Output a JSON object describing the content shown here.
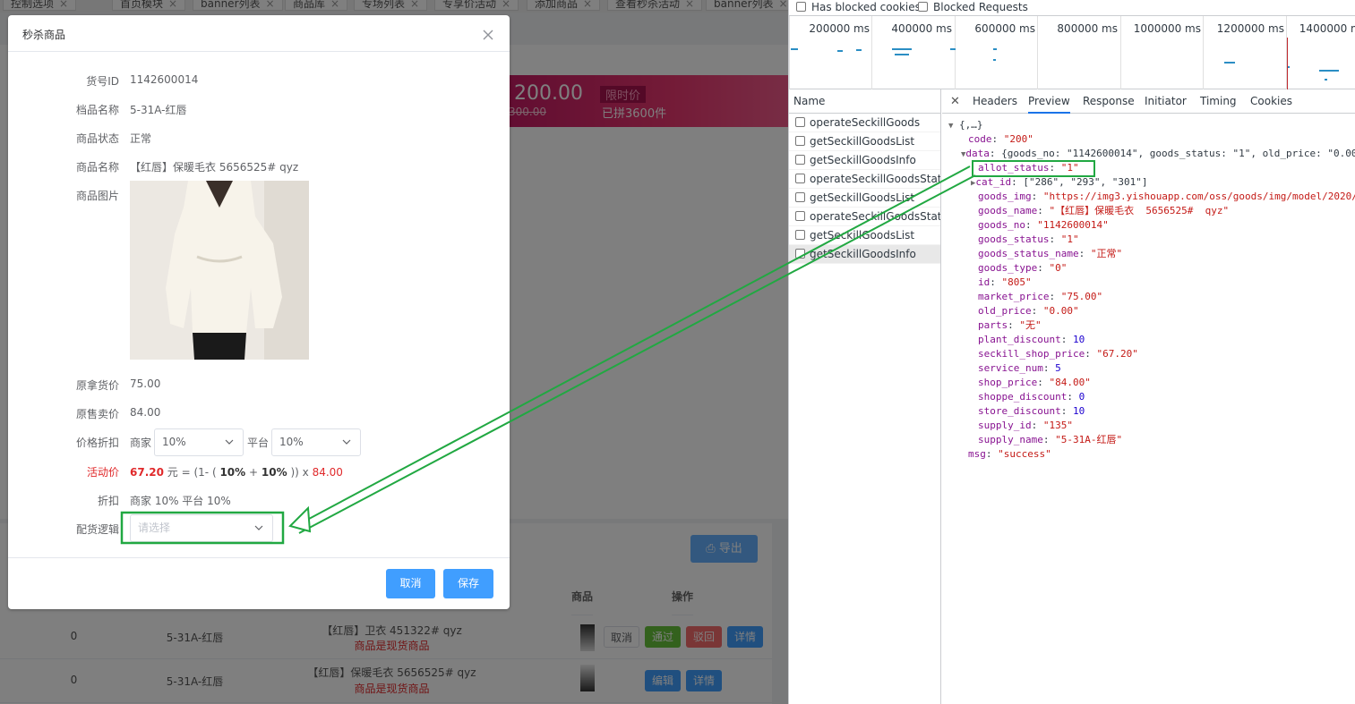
{
  "bg": {
    "tabs": [
      "控制选项",
      "首页模块",
      "banner列表",
      "商品库",
      "专场列表",
      "专享价活动",
      "添加商品",
      "查看秒杀活动",
      "banner列表"
    ],
    "banner_price": "200.00",
    "banner_old": "300.00",
    "banner_tag": "限时价",
    "banner_sold": "已拼3600件",
    "export_label": "导出",
    "table_headers": {
      "goods": "商品",
      "actions": "操作"
    },
    "rows": [
      {
        "count": "0",
        "supplier": "5-31A-红唇",
        "name": "【红唇】卫衣 451322# qyz",
        "note": "商品是现货商品",
        "btn_cancel": "取消",
        "btn_pass": "通过",
        "btn_reject": "驳回",
        "btn_detail": "详情"
      },
      {
        "count": "0",
        "supplier": "5-31A-红唇",
        "name": "【红唇】保暖毛衣 5656525# qyz",
        "note": "商品是现货商品",
        "btn_edit": "编辑",
        "btn_detail": "详情"
      }
    ]
  },
  "dialog": {
    "title": "秒杀商品",
    "fields": {
      "goods_id_label": "货号ID",
      "goods_id": "1142600014",
      "supplier_label": "档品名称",
      "supplier": "5-31A-红唇",
      "status_label": "商品状态",
      "status": "正常",
      "name_label": "商品名称",
      "name": "【红唇】保暖毛衣 5656525# qyz",
      "image_label": "商品图片",
      "cost_label": "原拿货价",
      "cost": "75.00",
      "sale_label": "原售卖价",
      "sale": "84.00",
      "discount_label": "价格折扣",
      "merchant_label": "商家",
      "merchant_value": "10%",
      "platform_label": "平台",
      "platform_value": "10%",
      "activity_label": "活动价",
      "activity_price": "67.20",
      "formula_a": "元 = (1- (",
      "formula_pct1": "10%",
      "formula_plus": "+",
      "formula_pct2": "10%",
      "formula_b": ")) x",
      "formula_base": "84.00",
      "rebate_label": "折扣",
      "rebate_value": "商家 10% 平台 10%",
      "delivery_label": "配货逻辑",
      "delivery_placeholder": "请选择"
    },
    "cancel_label": "取消",
    "save_label": "保存"
  },
  "devtools": {
    "filter_blocked_cookies": "Has blocked cookies",
    "filter_blocked_requests": "Blocked Requests",
    "timeline_labels": [
      "200000 ms",
      "400000 ms",
      "600000 ms",
      "800000 ms",
      "1000000 ms",
      "1200000 ms",
      "1400000 ms"
    ],
    "names_header": "Name",
    "requests": [
      "operateSeckillGoods",
      "getSeckillGoodsList",
      "getSeckillGoodsInfo",
      "operateSeckillGoodsStatus",
      "getSeckillGoodsList",
      "operateSeckillGoodsStatus",
      "getSeckillGoodsList",
      "getSeckillGoodsInfo"
    ],
    "tabs": [
      "Headers",
      "Preview",
      "Response",
      "Initiator",
      "Timing",
      "Cookies"
    ],
    "active_tab": "Preview",
    "json_root": "{,…}",
    "json_lines": [
      {
        "k": "code",
        "v": "\"200\"",
        "t": "s"
      },
      {
        "k": "data",
        "v": "{goods_no: \"1142600014\", goods_status: \"1\", old_price: \"0.00\"",
        "t": "p"
      },
      {
        "k": "allot_status",
        "v": "\"1\"",
        "t": "s"
      },
      {
        "k": "cat_id",
        "v": "[\"286\", \"293\", \"301\"]",
        "t": "p"
      },
      {
        "k": "goods_img",
        "v": "\"https://img3.yishouapp.com/oss/goods/img/model/2020/",
        "t": "s"
      },
      {
        "k": "goods_name",
        "v": "\"【红唇】保暖毛衣  5656525#  qyz\"",
        "t": "s"
      },
      {
        "k": "goods_no",
        "v": "\"1142600014\"",
        "t": "s"
      },
      {
        "k": "goods_status",
        "v": "\"1\"",
        "t": "s"
      },
      {
        "k": "goods_status_name",
        "v": "\"正常\"",
        "t": "s"
      },
      {
        "k": "goods_type",
        "v": "\"0\"",
        "t": "s"
      },
      {
        "k": "id",
        "v": "\"805\"",
        "t": "s"
      },
      {
        "k": "market_price",
        "v": "\"75.00\"",
        "t": "s"
      },
      {
        "k": "old_price",
        "v": "\"0.00\"",
        "t": "s"
      },
      {
        "k": "parts",
        "v": "\"无\"",
        "t": "s"
      },
      {
        "k": "plant_discount",
        "v": "10",
        "t": "n"
      },
      {
        "k": "seckill_shop_price",
        "v": "\"67.20\"",
        "t": "s"
      },
      {
        "k": "service_num",
        "v": "5",
        "t": "n"
      },
      {
        "k": "shop_price",
        "v": "\"84.00\"",
        "t": "s"
      },
      {
        "k": "shoppe_discount",
        "v": "0",
        "t": "n"
      },
      {
        "k": "store_discount",
        "v": "10",
        "t": "n"
      },
      {
        "k": "supply_id",
        "v": "\"135\"",
        "t": "s"
      },
      {
        "k": "supply_name",
        "v": "\"5-31A-红唇\"",
        "t": "s"
      },
      {
        "k": "msg",
        "v": "\"success\"",
        "t": "s"
      }
    ]
  },
  "colors": {
    "primary": "#409eff",
    "highlight": "#21a842",
    "price_red": "#e0292b"
  }
}
